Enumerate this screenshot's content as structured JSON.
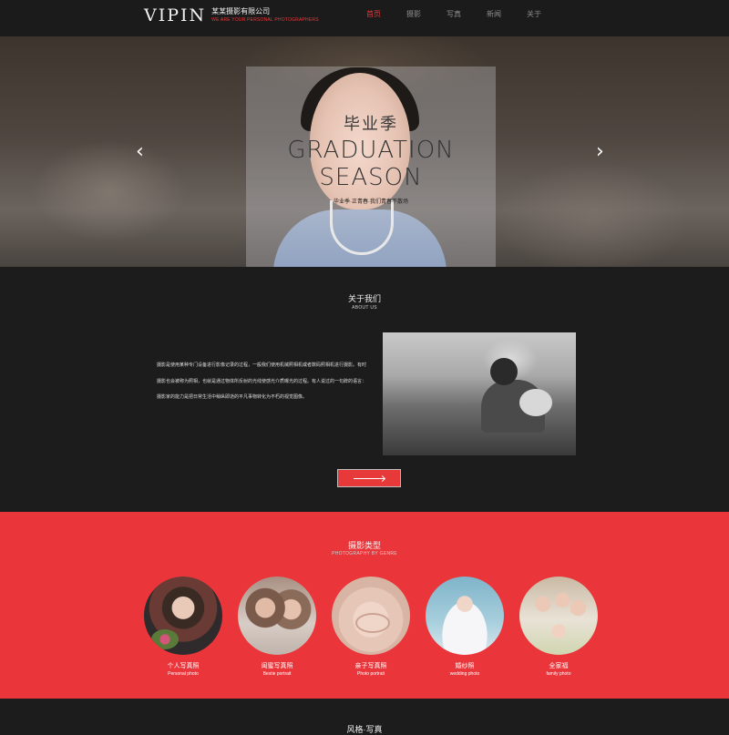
{
  "header": {
    "logo_mark": "VIPIN",
    "company_cn": "某某摄影有限公司",
    "company_en": "WE ARE YOUR PERSONAL PHOTOGRAPHERS",
    "nav": [
      {
        "label": "首页",
        "active": true
      },
      {
        "label": "摄影",
        "active": false
      },
      {
        "label": "写真",
        "active": false
      },
      {
        "label": "新闻",
        "active": false
      },
      {
        "label": "关于",
        "active": false
      }
    ]
  },
  "hero": {
    "title_cn": "毕业季",
    "title_en_line1": "GRADUATION",
    "title_en_line2": "SEASON",
    "subtitle": "毕业季·正青春·我们青春不散场",
    "prev_arrow": "‹",
    "next_arrow": "›"
  },
  "about": {
    "title": "关于我们",
    "subtitle": "ABOUT US",
    "paragraph": "摄影是使用某种专门设备进行影像记录的过程，一般我们使用机械照相机或者数码照相机进行摄影。有时摄影也会被称为照相，也就是通过物体所反射的光线使感光介质曝光的过程。有人说过的一句辞的语言：摄影家的能力是把日常生活中稍纵即逝的平凡事物转化为不朽的视觉图像。"
  },
  "genre": {
    "title": "摄影类型",
    "subtitle": "PHOTOGRAPHY BY GENRE",
    "items": [
      {
        "cn": "个人写真照",
        "en": "Personal photo"
      },
      {
        "cn": "闺蜜写真照",
        "en": "Bestie portrait"
      },
      {
        "cn": "亲子写真照",
        "en": "Photo portrait"
      },
      {
        "cn": "婚纱照",
        "en": "wedding photo"
      },
      {
        "cn": "全家福",
        "en": "family photo"
      }
    ]
  },
  "style_section": {
    "title": "风格·写真"
  },
  "colors": {
    "accent": "#e7393a",
    "dark_bg": "#1c1c1c",
    "genre_bg": "#ea363a"
  }
}
